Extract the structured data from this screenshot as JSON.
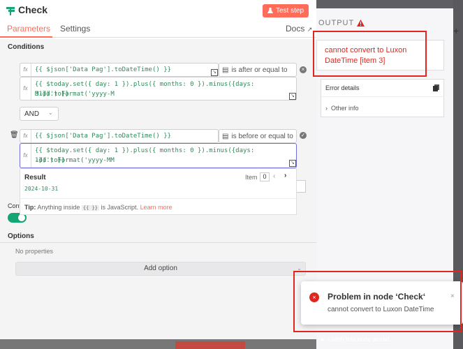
{
  "header": {
    "title": "Check",
    "test_step_label": "Test step"
  },
  "tabs": {
    "parameters": "Parameters",
    "settings": "Settings",
    "docs": "Docs"
  },
  "conditions": {
    "section_label": "Conditions",
    "rows": [
      {
        "left_value": "{{ $json['Data Pag'].toDateTime() }}",
        "operator": "is after or equal to",
        "right_value_line1": "{{ $today.set({ day: 1 }).plus({ months: 0 }).minus({days: 31}).toFormat('yyyy-M",
        "right_value_line2": "M-dd') }}"
      },
      {
        "left_value": "{{ $json['Data Pag'].toDateTime() }}",
        "operator": "is before or equal to",
        "right_value_line1": "{{ $today.set({ day: 1 }).plus({ months: 0 }).minus({days: 1}).toFormat('yyyy-MM",
        "right_value_line2": "-dd') }}"
      }
    ],
    "combinator": "AND",
    "fx_label": "fx"
  },
  "result": {
    "label": "Result",
    "item_label": "Item",
    "item_index": "0",
    "value": "2024-10-31",
    "tip_prefix": "Tip:",
    "tip_text": "Anything inside",
    "tip_code": "{{ }}",
    "tip_suffix": "is JavaScript.",
    "tip_link": "Learn more"
  },
  "convert_label": "Conv",
  "options": {
    "label": "Options",
    "empty": "No properties",
    "add_label": "Add option"
  },
  "output": {
    "title": "OUTPUT",
    "error_message": "cannot convert to Luxon DateTime [item 3]",
    "details_label": "Error details",
    "other_info": "Other info"
  },
  "toast": {
    "title": "Problem in node ‘Check‘",
    "message": "cannot convert to Luxon DateTime"
  },
  "footer_hint": "I wish this node would...",
  "colors": {
    "accent": "#ff6d5a",
    "error": "#e0261f",
    "success": "#13a574",
    "code": "#2f8a5a"
  }
}
